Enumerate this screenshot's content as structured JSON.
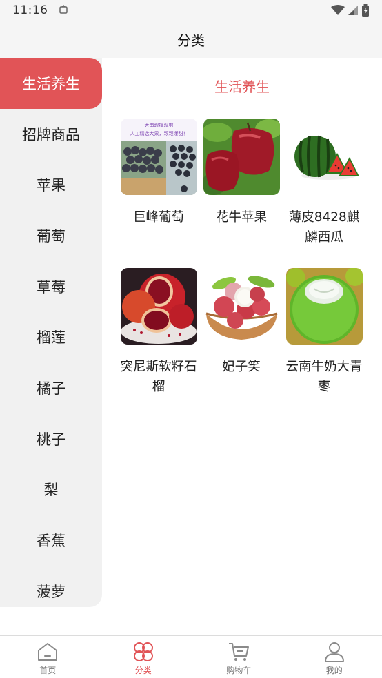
{
  "status_bar": {
    "time": "11:16"
  },
  "header": {
    "title": "分类"
  },
  "sidebar": {
    "items": [
      {
        "label": "生活养生",
        "active": true
      },
      {
        "label": "招牌商品"
      },
      {
        "label": "苹果"
      },
      {
        "label": "葡萄"
      },
      {
        "label": "草莓"
      },
      {
        "label": "榴莲"
      },
      {
        "label": "橘子"
      },
      {
        "label": "桃子"
      },
      {
        "label": "梨"
      },
      {
        "label": "香蕉"
      },
      {
        "label": "菠萝"
      }
    ]
  },
  "main": {
    "section_title": "生活养生",
    "products": [
      {
        "name": "巨峰葡萄",
        "image": "grapes-photo",
        "image_text_1": "大串现摘现剪",
        "image_text_2": "人工精选大果，颗颗爆甜！"
      },
      {
        "name": "花牛苹果",
        "image": "apples-photo"
      },
      {
        "name": "薄皮8428麒麟西瓜",
        "image": "watermelon-photo"
      },
      {
        "name": "突尼斯软籽石榴",
        "image": "pomegranate-photo"
      },
      {
        "name": "妃子笑",
        "image": "lychee-photo"
      },
      {
        "name": "云南牛奶大青枣",
        "image": "jujube-photo"
      }
    ]
  },
  "tabbar": {
    "tabs": [
      {
        "label": "首页",
        "icon": "home-icon"
      },
      {
        "label": "分类",
        "icon": "category-icon",
        "active": true
      },
      {
        "label": "购物车",
        "icon": "cart-icon"
      },
      {
        "label": "我的",
        "icon": "user-icon"
      }
    ]
  },
  "colors": {
    "accent": "#e15457",
    "sidebar_bg": "#f1f1f1",
    "header_bg": "#f5f5f5"
  }
}
